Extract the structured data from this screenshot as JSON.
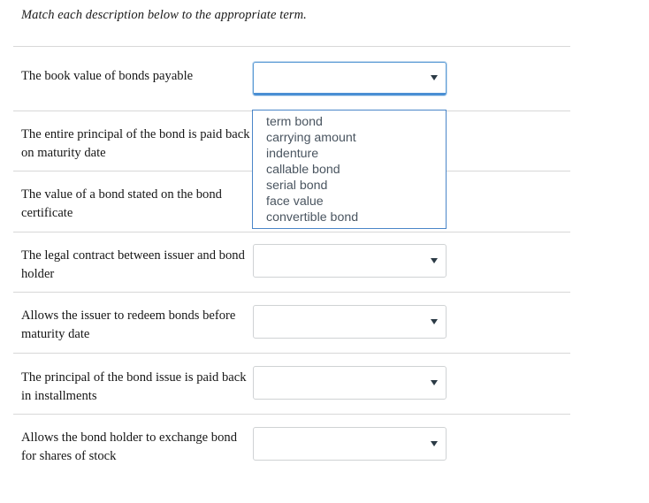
{
  "instruction": "Match each description below to the appropriate term.",
  "colors": {
    "focus_border": "#5b9bd5",
    "idle_border": "#cfd2d4",
    "divider": "#d8d8d8",
    "dropdown_border": "#4a86c8",
    "dropdown_text": "#4a5560",
    "description_text": "#161616"
  },
  "rows": [
    {
      "description": "The book value of bonds payable",
      "selected": "",
      "focused": true
    },
    {
      "description": "The entire principal of the bond is paid back on maturity date",
      "selected": "",
      "focused": false
    },
    {
      "description": "The value of a bond stated on the bond certificate",
      "selected": "",
      "focused": false
    },
    {
      "description": "The legal contract between issuer and bond holder",
      "selected": "",
      "focused": false
    },
    {
      "description": "Allows the issuer to redeem bonds before maturity date",
      "selected": "",
      "focused": false
    },
    {
      "description": "The principal of the bond issue is paid back in installments",
      "selected": "",
      "focused": false
    },
    {
      "description": "Allows the bond holder to exchange bond for shares of stock",
      "selected": "",
      "focused": false
    }
  ],
  "dropdown": {
    "open": true,
    "owner_row": 0,
    "options": [
      "term bond",
      "carrying amount",
      "indenture",
      "callable bond",
      "serial bond",
      "face value",
      "convertible bond"
    ]
  }
}
